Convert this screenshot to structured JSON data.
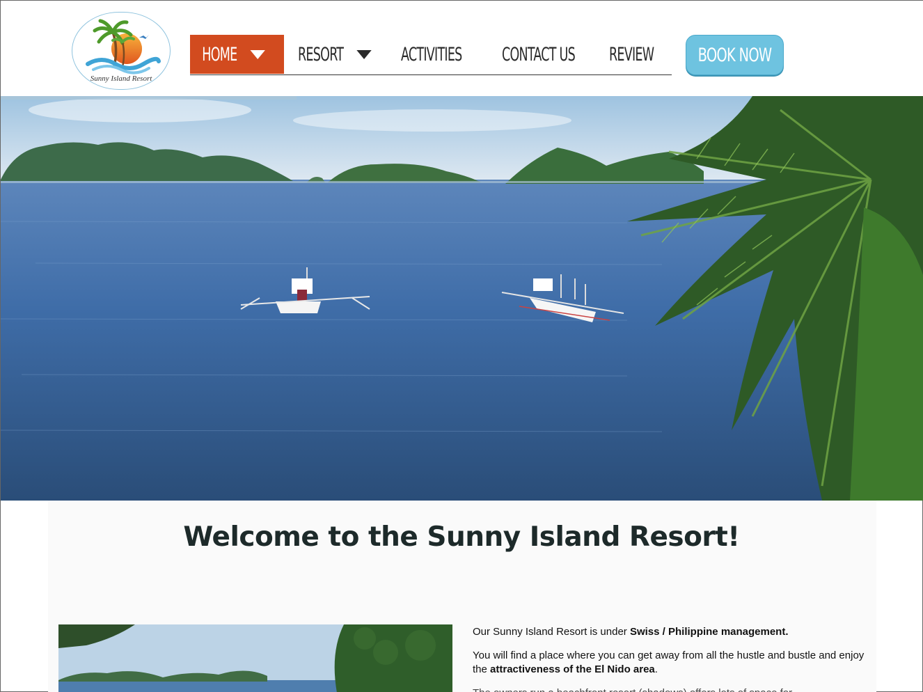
{
  "brand": {
    "name": "Sunny Island Resort",
    "logo_icon": "palm-sun-wave-logo"
  },
  "nav": {
    "items": [
      {
        "label": "HOME",
        "has_dropdown": true,
        "active": true
      },
      {
        "label": "RESORT",
        "has_dropdown": true,
        "active": false
      },
      {
        "label": "ACTIVITIES",
        "has_dropdown": false,
        "active": false
      },
      {
        "label": "CONTACT US",
        "has_dropdown": false,
        "active": false
      },
      {
        "label": "REVIEW",
        "has_dropdown": false,
        "active": false
      }
    ],
    "book_label": "BOOK NOW"
  },
  "colors": {
    "nav_active": "#d24b1f",
    "book_button": "#6ec3e0",
    "heading": "#1d2a2a"
  },
  "main": {
    "heading": "Welcome to the Sunny Island Resort!",
    "para1_pre": "Our Sunny Island Resort is under ",
    "para1_bold": "Swiss / Philippine management.",
    "para2_pre": "You will find a place where you can get away from all the hustle and bustle and enjoy the ",
    "para2_bold": "attractiveness of the El Nido area",
    "para2_post": ".",
    "para3_partial": "The owners run a beachfront resort (shadows) offers lots of space for"
  }
}
